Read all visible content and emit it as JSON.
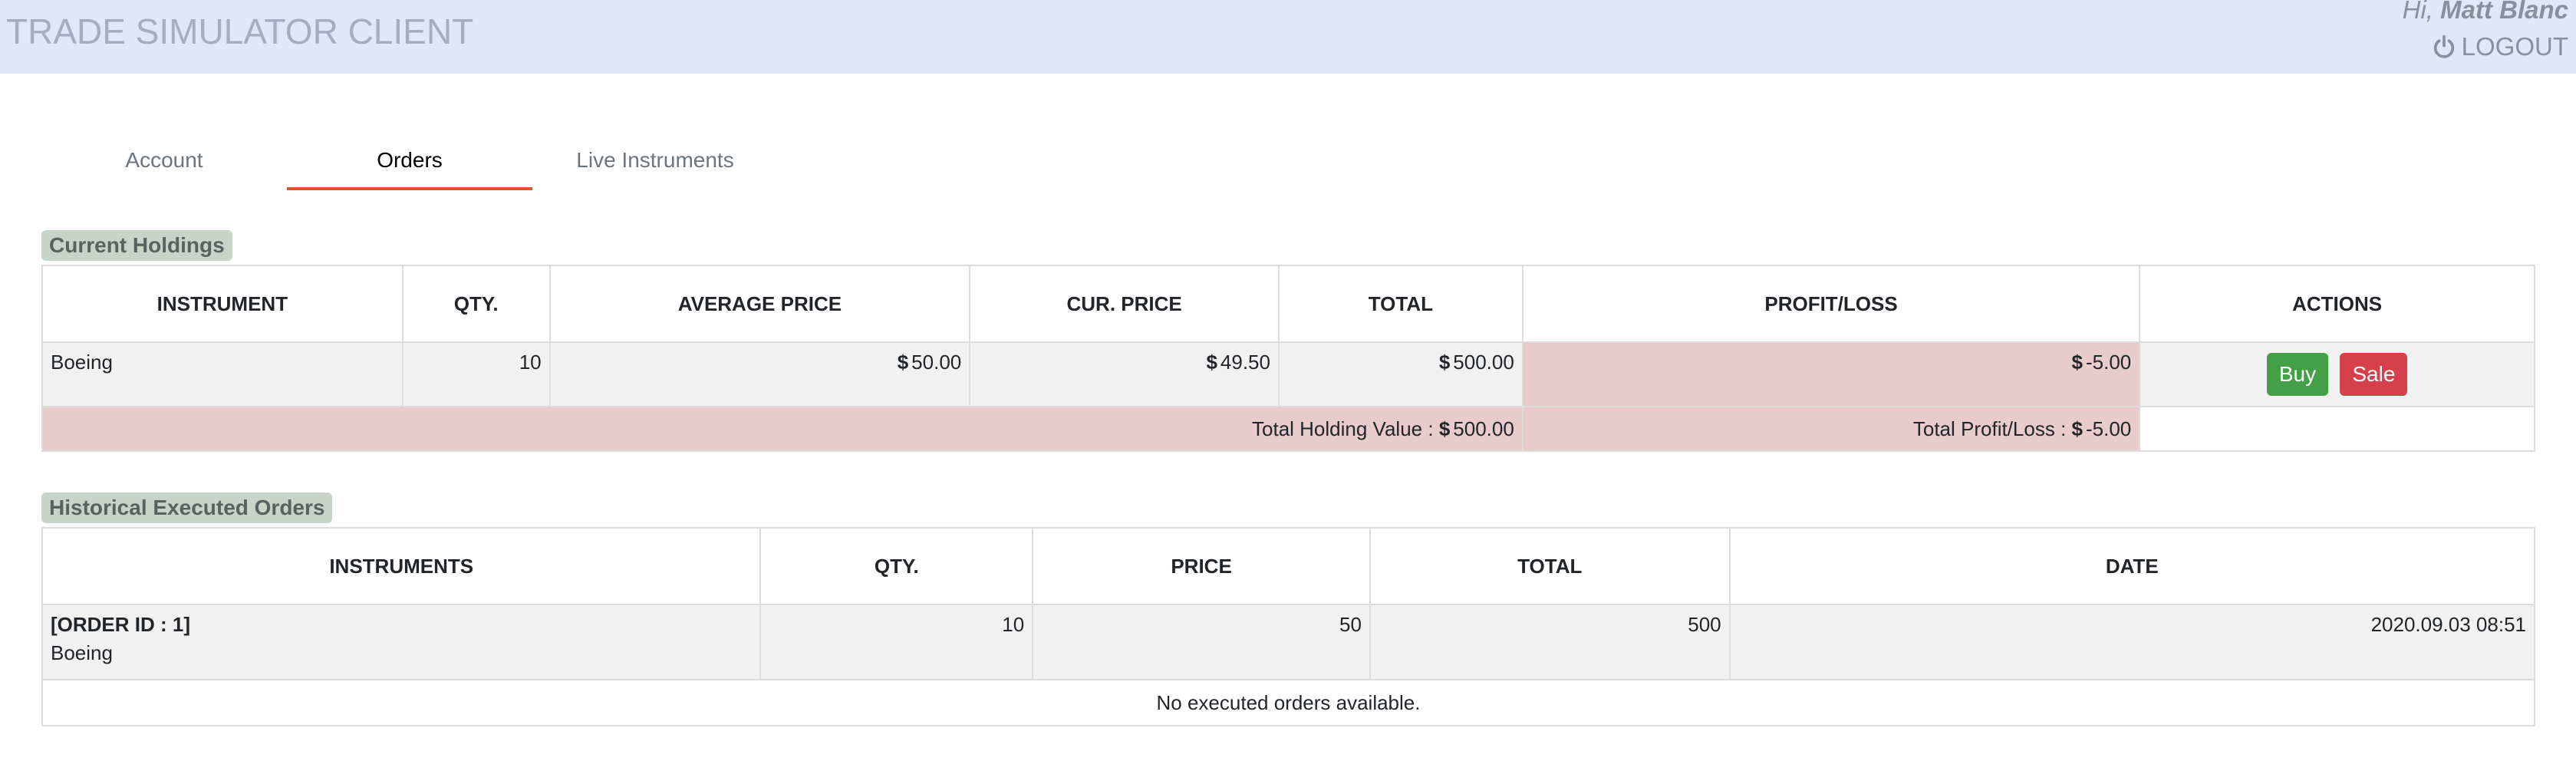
{
  "header": {
    "app_title": "TRADE SIMULATOR CLIENT",
    "greeting_prefix": "Hi,",
    "user_name": "Matt Blanc",
    "logout_label": "LOGOUT"
  },
  "tabs": [
    {
      "label": "Account"
    },
    {
      "label": "Orders"
    },
    {
      "label": "Live Instruments"
    }
  ],
  "holdings": {
    "title": "Current Holdings",
    "columns": [
      "INSTRUMENT",
      "QTY.",
      "AVERAGE PRICE",
      "CUR. PRICE",
      "TOTAL",
      "PROFIT/LOSS",
      "ACTIONS"
    ],
    "rows": [
      {
        "instrument": "Boeing",
        "qty": "10",
        "avg_price": "50.00",
        "cur_price": "49.50",
        "total": "500.00",
        "pnl": "-5.00"
      }
    ],
    "currency_symbol": "$",
    "buy_label": "Buy",
    "sale_label": "Sale",
    "total_value_label": "Total Holding Value :",
    "total_value": "500.00",
    "total_pnl_label": "Total Profit/Loss :",
    "total_pnl": "-5.00"
  },
  "history": {
    "title": "Historical Executed Orders",
    "columns": [
      "INSTRUMENTS",
      "QTY.",
      "PRICE",
      "TOTAL",
      "DATE"
    ],
    "rows": [
      {
        "order_id": "[ORDER ID : 1]",
        "instrument": "Boeing",
        "qty": "10",
        "price": "50",
        "total": "500",
        "date": "2020.09.03 08:51"
      }
    ],
    "empty_message": "No executed orders available."
  },
  "colors": {
    "header_bg": "#e0e7fb",
    "tab_active_underline": "#e0542d",
    "loss_bg": "#e8cbcd",
    "buy": "#43a047",
    "sale": "#d6404b"
  }
}
